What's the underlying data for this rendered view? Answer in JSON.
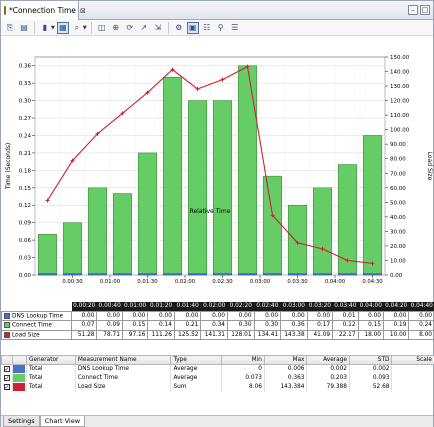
{
  "window": {
    "tab_title": "*Connection Time",
    "tab_close": "⊠"
  },
  "toolbar": {
    "buttons": [
      "copy-icon",
      "paste-icon",
      "bar-chart-icon",
      "chart-mode-icon",
      "zoom-icon",
      "pan-icon",
      "marker-icon",
      "sync-icon",
      "line-icon",
      "export-icon",
      "settings-icon",
      "grid-icon",
      "table-icon"
    ]
  },
  "chart_data": {
    "type": "bar",
    "xlabel": "Relative Time",
    "ylabel": "Time (Seconds)",
    "y2label": "Load Size",
    "ylim": [
      0,
      0.375
    ],
    "y2lim": [
      0,
      150
    ],
    "yticks": [
      "0.00",
      "0.03",
      "0.06",
      "0.09",
      "0.12",
      "0.15",
      "0.18",
      "0.21",
      "0.24",
      "0.27",
      "0.30",
      "0.33",
      "0.36"
    ],
    "y2ticks": [
      "0.00",
      "10.00",
      "20.00",
      "30.00",
      "40.00",
      "50.00",
      "60.00",
      "70.00",
      "80.00",
      "90.00",
      "100.00",
      "110.00",
      "120.00",
      "130.00",
      "140.00",
      "150.00"
    ],
    "xticks": [
      "0.00:30",
      "0.01:00",
      "0.01:30",
      "0.02:00",
      "0.02:30",
      "0.03:00",
      "0.03:30",
      "0.04:00",
      "0.04:30"
    ],
    "categories": [
      "0.00:20",
      "0.00:40",
      "0.01:00",
      "0.01:20",
      "0.01:40",
      "0.02:00",
      "0.02:20",
      "0.02:40",
      "0.03:00",
      "0.03:20",
      "0.03:40",
      "0.04:00",
      "0.04:20",
      "0.04:40"
    ],
    "series": [
      {
        "name": "DNS Lookup Time",
        "color": "#4a6fc8",
        "axis": "left",
        "type": "bar",
        "values": [
          0.0,
          0.0,
          0.0,
          0.0,
          0.0,
          0.0,
          0.0,
          0.0,
          0.0,
          0.0,
          0.0,
          0.0,
          0.0,
          0.0
        ]
      },
      {
        "name": "Connect Time",
        "color": "#66cc66",
        "axis": "left",
        "type": "bar",
        "values": [
          0.07,
          0.09,
          0.15,
          0.14,
          0.21,
          0.34,
          0.3,
          0.3,
          0.36,
          0.17,
          0.12,
          0.15,
          0.19,
          0.24
        ]
      },
      {
        "name": "Load Size",
        "color": "#cc2233",
        "axis": "right",
        "type": "line",
        "values": [
          51.28,
          78.71,
          97.16,
          111.26,
          125.52,
          141.31,
          128.01,
          134.41,
          143.38,
          41.09,
          22.17,
          18.0,
          10.0,
          8.0
        ]
      }
    ]
  },
  "data_table": {
    "columns": [
      "0.00:20",
      "0.00:40",
      "0.01:00",
      "0.01:20",
      "0.01:40",
      "0.02:00",
      "0.02:20",
      "0.02:40",
      "0.03:00",
      "0.03:20",
      "0.03:40",
      "0.04:00",
      "0.04:20",
      "0.04:40"
    ],
    "rows": [
      {
        "label": "DNS Lookup Time",
        "color": "#4a6fc8",
        "cells": [
          "0.00",
          "0.00",
          "0.00",
          "0.00",
          "0.00",
          "0.00",
          "0.00",
          "0.00",
          "0.00",
          "0.00",
          "0.01",
          "0.00",
          "0.00",
          "0.00"
        ]
      },
      {
        "label": "Connect Time",
        "color": "#66cc66",
        "cells": [
          "0.07",
          "0.09",
          "0.15",
          "0.14",
          "0.21",
          "0.34",
          "0.30",
          "0.30",
          "0.36",
          "0.17",
          "0.12",
          "0.15",
          "0.19",
          "0.24"
        ]
      },
      {
        "label": "Load Size",
        "color": "#cc2233",
        "cells": [
          "51.28",
          "78.71",
          "97.16",
          "111.26",
          "125.52",
          "141.31",
          "128.01",
          "134.41",
          "143.38",
          "41.09",
          "22.17",
          "18.00",
          "10.00",
          "8.00"
        ]
      }
    ]
  },
  "measurements": {
    "headers": [
      "",
      "",
      "Generator",
      "Measurement Name",
      "Type",
      "Min",
      "Max",
      "Average",
      "STD",
      "Scale"
    ],
    "rows": [
      {
        "checked": "✓",
        "color": "#4a6fc8",
        "generator": "Total",
        "name": "DNS Lookup Time",
        "type": "Average",
        "min": "0",
        "max": "0.006",
        "avg": "0.002",
        "std": "0.002",
        "scale": ""
      },
      {
        "checked": "✓",
        "color": "#66cc66",
        "generator": "Total",
        "name": "Connect Time",
        "type": "Average",
        "min": "0.073",
        "max": "0.363",
        "avg": "0.203",
        "std": "0.093",
        "scale": ""
      },
      {
        "checked": "✓",
        "color": "#cc2233",
        "generator": "Total",
        "name": "Load Size",
        "type": "Sum",
        "min": "8.06",
        "max": "143.384",
        "avg": "79.388",
        "std": "52.68",
        "scale": ""
      }
    ]
  },
  "bottom_tabs": [
    "Settings",
    "Chart View"
  ]
}
